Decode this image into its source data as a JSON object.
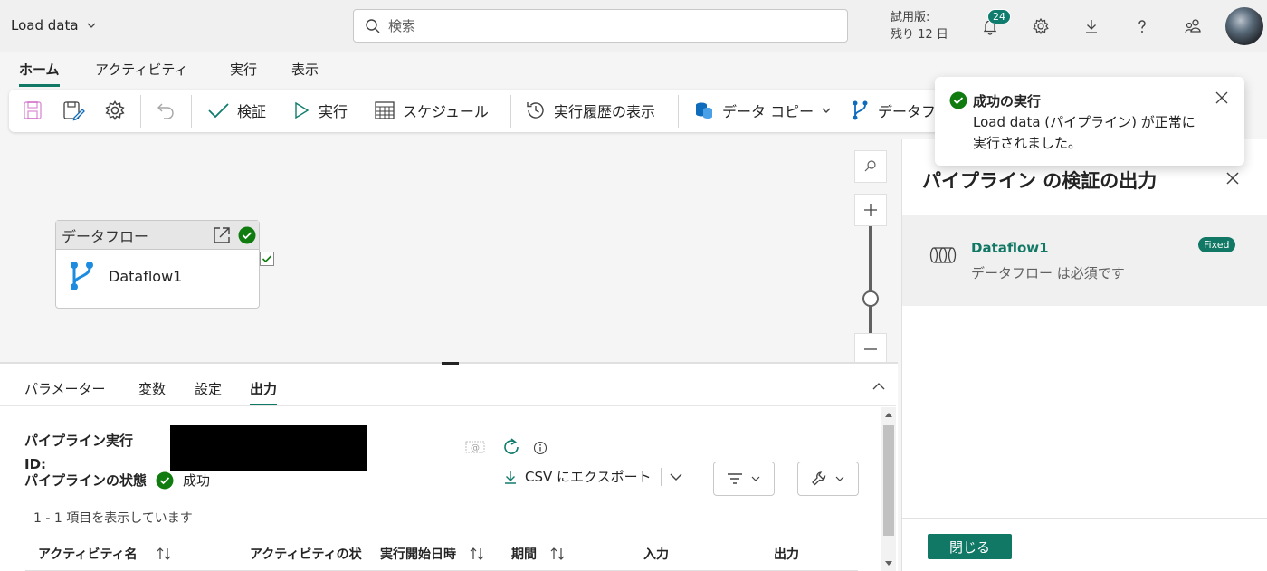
{
  "app": {
    "title": "Load data"
  },
  "search": {
    "placeholder": "検索"
  },
  "trial": {
    "line1": "試用版:",
    "line2": "残り 12 日"
  },
  "notifications": {
    "count": "24"
  },
  "tabs": [
    {
      "label": "ホーム",
      "active": true
    },
    {
      "label": "アクティビティ"
    },
    {
      "label": "実行"
    },
    {
      "label": "表示"
    }
  ],
  "ribbon": {
    "validate": "検証",
    "run": "実行",
    "schedule": "スケジュール",
    "history": "実行履歴の表示",
    "copy_data": "データ コピー",
    "dataflow": "データフ"
  },
  "node": {
    "header": "データフロー",
    "name": "Dataflow1"
  },
  "bottom": {
    "tabs": [
      {
        "label": "パラメーター"
      },
      {
        "label": "変数"
      },
      {
        "label": "設定"
      },
      {
        "label": "出力",
        "active": true
      }
    ],
    "run_id_label_1": "パイプライン実行",
    "run_id_label_2": "ID:",
    "status_label": "パイプラインの状態",
    "status_value": "成功",
    "items_count": "1 - 1 項目を表示しています",
    "export": "CSV にエクスポート",
    "columns": [
      "アクティビティ名",
      "アクティビティの状",
      "実行開始日時",
      "期間",
      "入力",
      "出力"
    ]
  },
  "side": {
    "title": "パイプライン の検証の出力",
    "item_name": "Dataflow1",
    "item_desc": "データフロー は必須です",
    "badge": "Fixed",
    "close": "閉じる"
  },
  "toast": {
    "title": "成功の実行",
    "line1": "Load data (パイプライン) が正常に",
    "line2": "実行されました。"
  },
  "colors": {
    "accent": "#117865",
    "success": "#107c10"
  }
}
